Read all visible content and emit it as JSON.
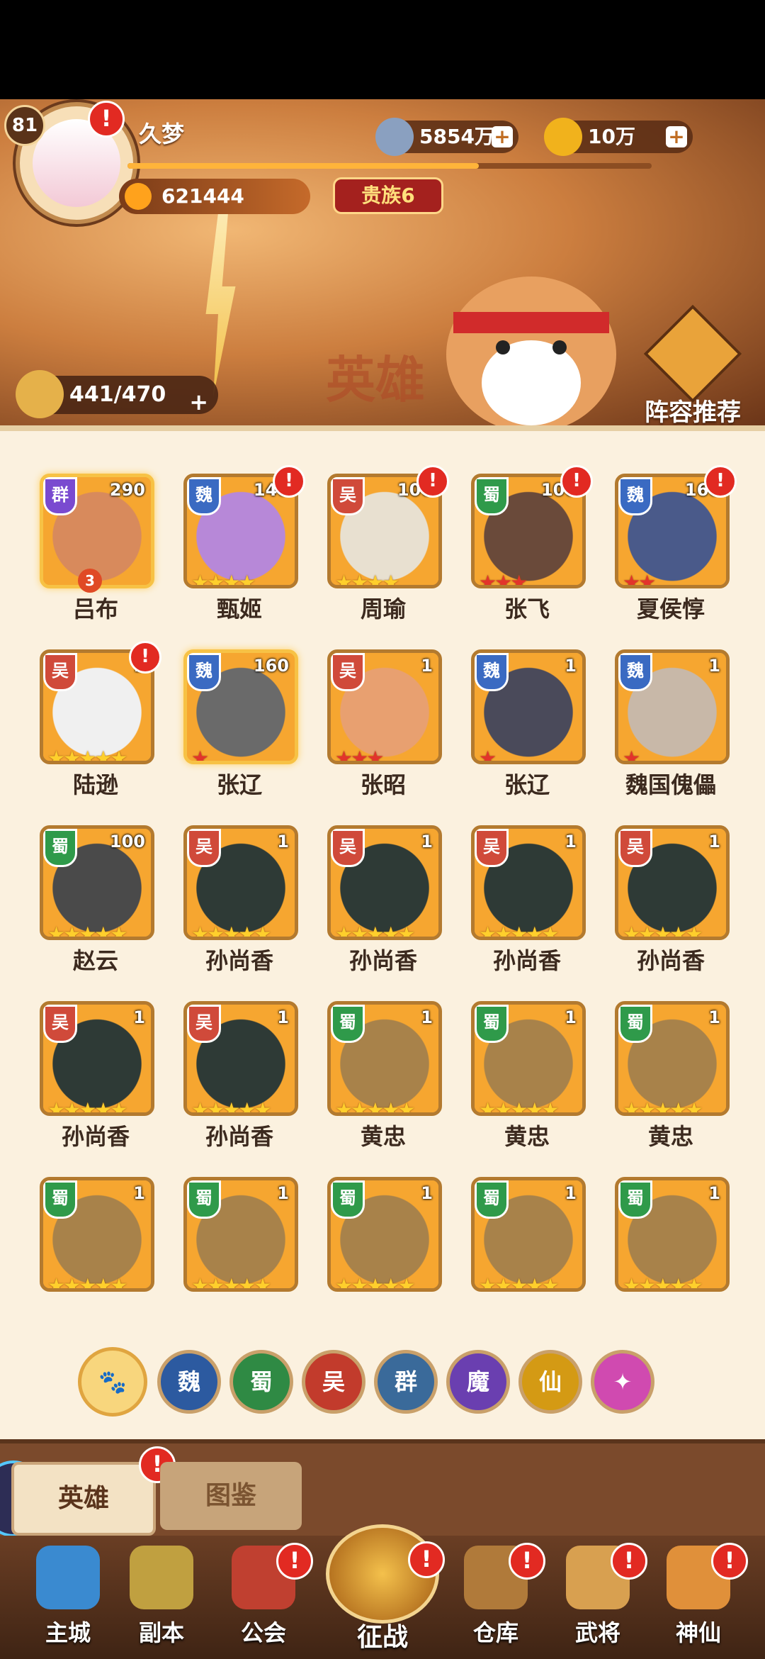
{
  "player": {
    "level": "81",
    "name": "久梦",
    "power": "621444",
    "noble": "贵族6",
    "exp_fraction": 0.67
  },
  "currency": {
    "silver": "5854万",
    "gold": "10万"
  },
  "header": {
    "hero_capacity": "441/470",
    "lineup_label": "阵容推荐",
    "watermark": "英雄"
  },
  "heroes": [
    {
      "name": "吕布",
      "faction": "群",
      "level": "290",
      "stars": "",
      "rank": "3",
      "alert": false
    },
    {
      "name": "甄姬",
      "faction": "魏",
      "level": "140",
      "stars": "★★★★",
      "rank": "",
      "alert": true
    },
    {
      "name": "周瑜",
      "faction": "吴",
      "level": "100",
      "stars": "★★★★",
      "rank": "",
      "alert": true
    },
    {
      "name": "张飞",
      "faction": "蜀",
      "level": "100",
      "stars": "★★★",
      "rank": "",
      "alert": true
    },
    {
      "name": "夏侯惇",
      "faction": "魏",
      "level": "160",
      "stars": "★★",
      "rank": "",
      "alert": true
    },
    {
      "name": "陆逊",
      "faction": "吴",
      "level": "1",
      "stars": "★★★★★",
      "rank": "",
      "alert": true
    },
    {
      "name": "张辽",
      "faction": "魏",
      "level": "160",
      "stars": "★",
      "rank": "",
      "alert": false
    },
    {
      "name": "张昭",
      "faction": "吴",
      "level": "1",
      "stars": "★★★",
      "rank": "",
      "alert": false
    },
    {
      "name": "张辽",
      "faction": "魏",
      "level": "1",
      "stars": "★",
      "rank": "",
      "alert": false
    },
    {
      "name": "魏国傀儡",
      "faction": "魏",
      "level": "1",
      "stars": "★",
      "rank": "",
      "alert": false
    },
    {
      "name": "赵云",
      "faction": "蜀",
      "level": "100",
      "stars": "★★★★★",
      "rank": "",
      "alert": false
    },
    {
      "name": "孙尚香",
      "faction": "吴",
      "level": "1",
      "stars": "★★★★★",
      "rank": "",
      "alert": false
    },
    {
      "name": "孙尚香",
      "faction": "吴",
      "level": "1",
      "stars": "★★★★★",
      "rank": "",
      "alert": false
    },
    {
      "name": "孙尚香",
      "faction": "吴",
      "level": "1",
      "stars": "★★★★★",
      "rank": "",
      "alert": false
    },
    {
      "name": "孙尚香",
      "faction": "吴",
      "level": "1",
      "stars": "★★★★★",
      "rank": "",
      "alert": false
    },
    {
      "name": "孙尚香",
      "faction": "吴",
      "level": "1",
      "stars": "★★★★★",
      "rank": "",
      "alert": false
    },
    {
      "name": "孙尚香",
      "faction": "吴",
      "level": "1",
      "stars": "★★★★★",
      "rank": "",
      "alert": false
    },
    {
      "name": "黄忠",
      "faction": "蜀",
      "level": "1",
      "stars": "★★★★★",
      "rank": "",
      "alert": false
    },
    {
      "name": "黄忠",
      "faction": "蜀",
      "level": "1",
      "stars": "★★★★★",
      "rank": "",
      "alert": false
    },
    {
      "name": "黄忠",
      "faction": "蜀",
      "level": "1",
      "stars": "★★★★★",
      "rank": "",
      "alert": false
    },
    {
      "name": "",
      "faction": "蜀",
      "level": "1",
      "stars": "★★★★★",
      "rank": "",
      "alert": false
    },
    {
      "name": "",
      "faction": "蜀",
      "level": "1",
      "stars": "★★★★★",
      "rank": "",
      "alert": false
    },
    {
      "name": "",
      "faction": "蜀",
      "level": "1",
      "stars": "★★★★★",
      "rank": "",
      "alert": false
    },
    {
      "name": "",
      "faction": "蜀",
      "level": "1",
      "stars": "★★★★★",
      "rank": "",
      "alert": false
    },
    {
      "name": "",
      "faction": "蜀",
      "level": "1",
      "stars": "★★★★★",
      "rank": "",
      "alert": false
    }
  ],
  "filters": [
    "魏",
    "蜀",
    "吴",
    "群",
    "魔",
    "仙"
  ],
  "filter_colors": {
    "魏": "#2c5aa0",
    "蜀": "#2f8a44",
    "吴": "#c23b2c",
    "群": "#3a6a9a",
    "魔": "#6a3fb0",
    "仙": "#d49a14",
    "all": "#f8d67d"
  },
  "tabs": {
    "heroes": "英雄",
    "codex": "图鉴"
  },
  "alert_mark": "!",
  "nav": [
    {
      "label": "主城",
      "alert": false
    },
    {
      "label": "副本",
      "alert": false
    },
    {
      "label": "公会",
      "alert": true
    },
    {
      "label": "征战",
      "alert": true
    },
    {
      "label": "仓库",
      "alert": true
    },
    {
      "label": "武将",
      "alert": true
    },
    {
      "label": "神仙",
      "alert": true
    }
  ],
  "colors": {
    "accent": "#e22a22",
    "panel": "#fbf1df",
    "frame": "#b37a2f"
  }
}
